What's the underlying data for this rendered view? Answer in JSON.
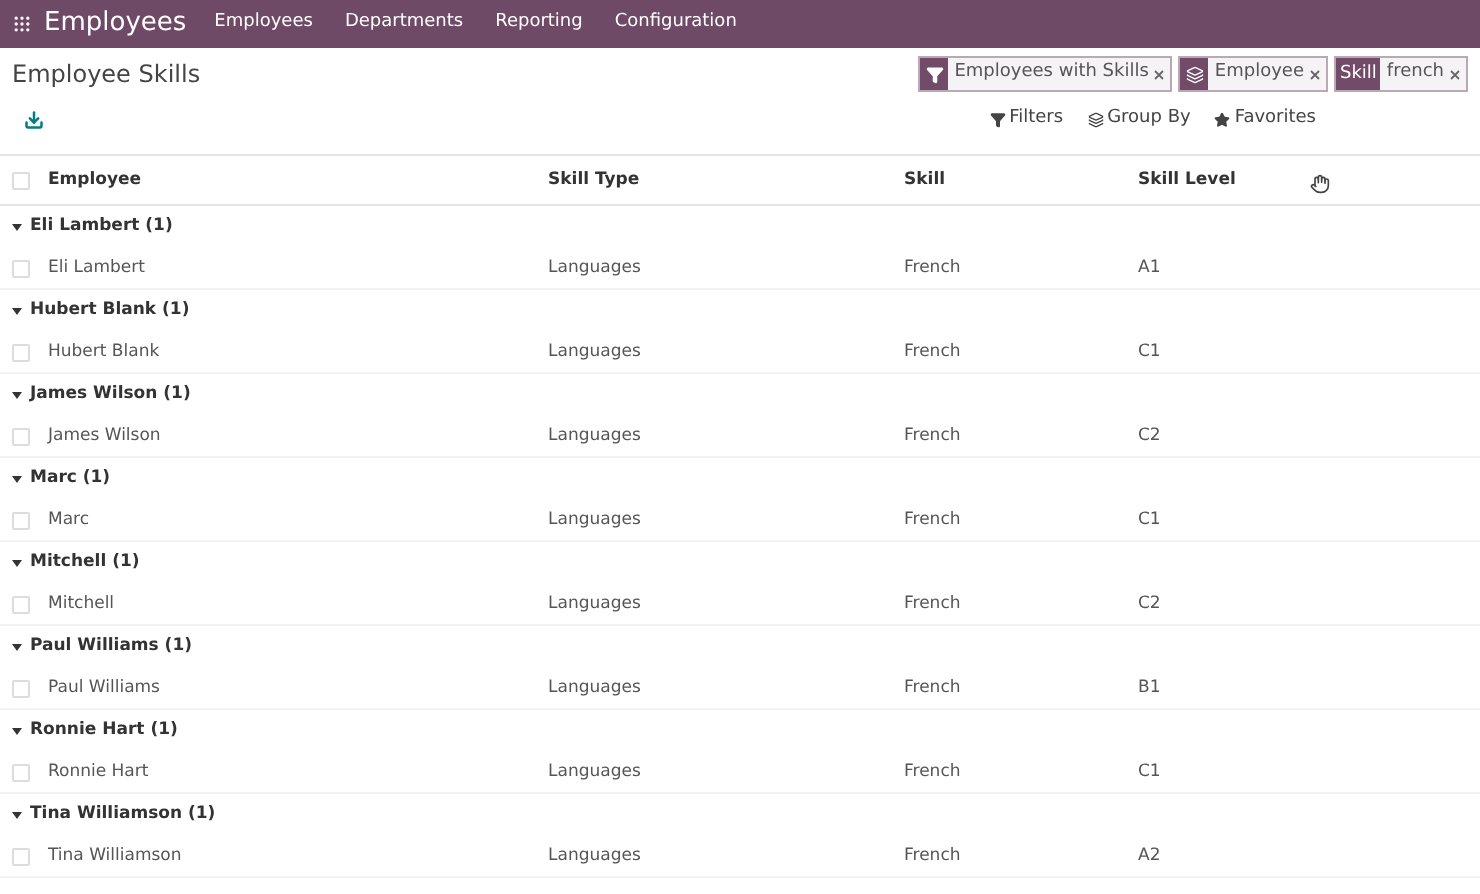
{
  "navbar": {
    "app_title": "Employees",
    "menu": [
      "Employees",
      "Departments",
      "Reporting",
      "Configuration"
    ]
  },
  "page": {
    "title": "Employee Skills"
  },
  "search": {
    "facets": [
      {
        "kind": "filter",
        "values": [
          "Employees with Skills"
        ]
      },
      {
        "kind": "groupby",
        "values": [
          "Employee"
        ]
      },
      {
        "kind": "field",
        "label": "Skill",
        "values": [
          "french"
        ]
      }
    ]
  },
  "search_options": [
    "Filters",
    "Group By",
    "Favorites"
  ],
  "table": {
    "select_all_checked": false,
    "columns": [
      "Employee",
      "Skill Type",
      "Skill",
      "Skill Level"
    ],
    "groups": [
      {
        "label": "Eli Lambert (1)",
        "expanded": true,
        "rows": [
          {
            "checked": false,
            "cells": [
              "Eli Lambert",
              "Languages",
              "French",
              "A1"
            ]
          }
        ]
      },
      {
        "label": "Hubert Blank (1)",
        "expanded": true,
        "rows": [
          {
            "checked": false,
            "cells": [
              "Hubert Blank",
              "Languages",
              "French",
              "C1"
            ]
          }
        ]
      },
      {
        "label": "James Wilson (1)",
        "expanded": true,
        "rows": [
          {
            "checked": false,
            "cells": [
              "James Wilson",
              "Languages",
              "French",
              "C2"
            ]
          }
        ]
      },
      {
        "label": "Marc (1)",
        "expanded": true,
        "rows": [
          {
            "checked": false,
            "cells": [
              "Marc",
              "Languages",
              "French",
              "C1"
            ]
          }
        ]
      },
      {
        "label": "Mitchell (1)",
        "expanded": true,
        "rows": [
          {
            "checked": false,
            "cells": [
              "Mitchell",
              "Languages",
              "French",
              "C2"
            ]
          }
        ]
      },
      {
        "label": "Paul Williams (1)",
        "expanded": true,
        "rows": [
          {
            "checked": false,
            "cells": [
              "Paul Williams",
              "Languages",
              "French",
              "B1"
            ]
          }
        ]
      },
      {
        "label": "Ronnie Hart (1)",
        "expanded": true,
        "rows": [
          {
            "checked": false,
            "cells": [
              "Ronnie Hart",
              "Languages",
              "French",
              "C1"
            ]
          }
        ]
      },
      {
        "label": "Tina Williamson (1)",
        "expanded": true,
        "rows": [
          {
            "checked": false,
            "cells": [
              "Tina Williamson",
              "Languages",
              "French",
              "A2"
            ]
          }
        ]
      }
    ]
  }
}
